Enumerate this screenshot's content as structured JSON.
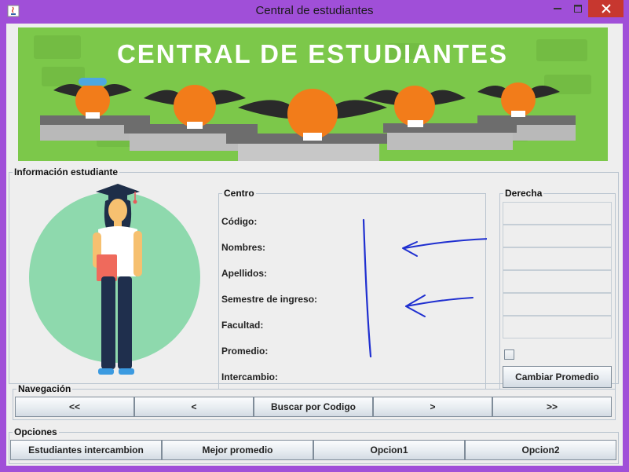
{
  "window": {
    "title": "Central de estudiantes",
    "controls": {
      "minimize_icon": "minimize-icon",
      "maximize_icon": "maximize-icon",
      "close_icon": "close-icon",
      "close_color": "#c7372f"
    },
    "frame_color": "#a04fd8"
  },
  "banner": {
    "title": "CENTRAL DE ESTUDIANTES",
    "background_color": "#7cc84a",
    "illustration": "cartoon-students-at-desks"
  },
  "info_panel": {
    "title": "Información estudiante",
    "illustration": "graduate-student-avatar",
    "centro": {
      "title": "Centro",
      "labels": [
        "Código:",
        "Nombres:",
        "Apellidos:",
        "Semestre de ingreso:",
        "Facultad:",
        "Promedio:",
        "Intercambio:"
      ]
    },
    "derecha": {
      "title": "Derecha",
      "fields": [
        "",
        "",
        "",
        "",
        "",
        ""
      ],
      "checkbox_checked": false,
      "change_average_button": "Cambiar Promedio"
    }
  },
  "navigation": {
    "title": "Navegación",
    "buttons": [
      "<<",
      "<",
      "Buscar por Codigo",
      ">",
      ">>"
    ]
  },
  "options": {
    "title": "Opciones",
    "buttons": [
      "Estudiantes intercambion",
      "Mejor promedio",
      "Opcion1",
      "Opcion2"
    ]
  },
  "annotations": {
    "color": "#1f2fd0"
  }
}
